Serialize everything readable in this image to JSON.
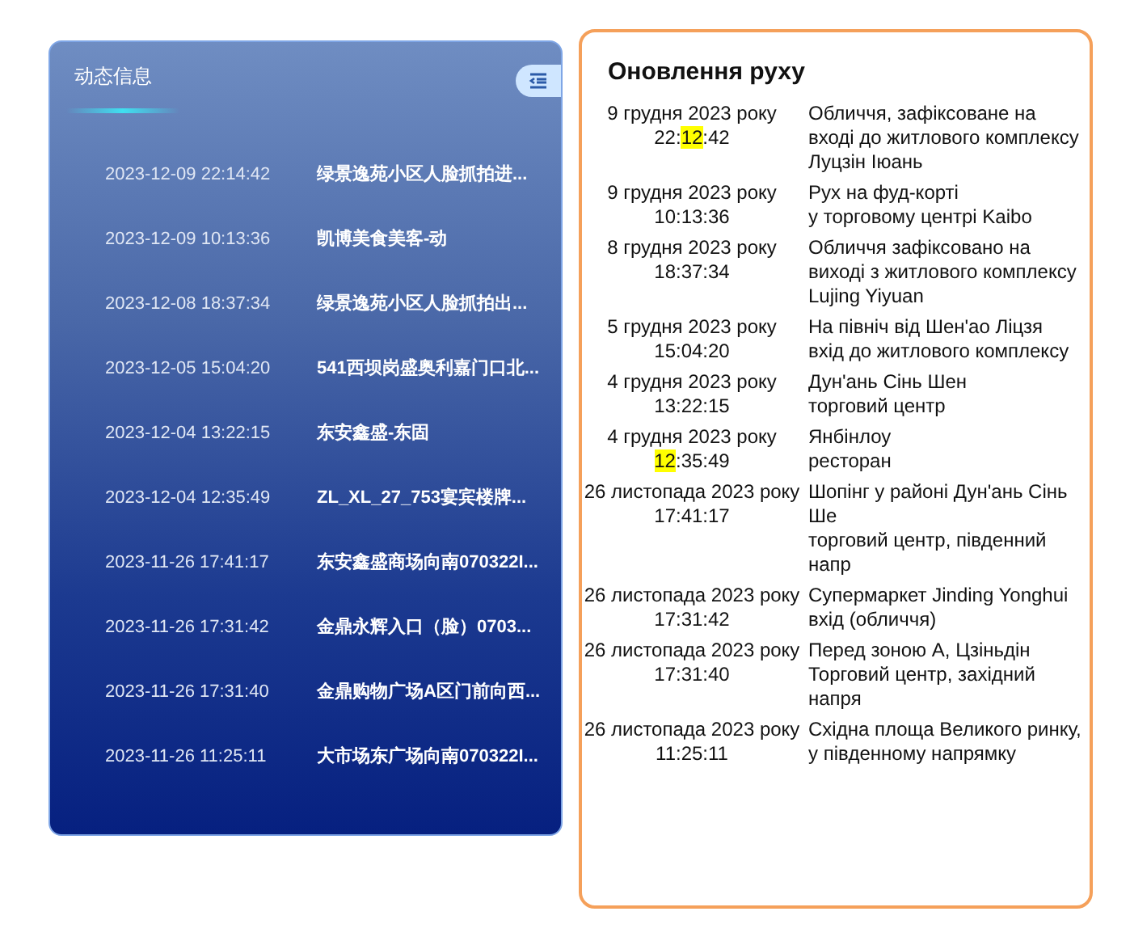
{
  "dynamic_panel": {
    "title": "动态信息",
    "items": [
      {
        "time": "2023-12-09 22:14:42",
        "text": "绿景逸苑小区人脸抓拍进..."
      },
      {
        "time": "2023-12-09 10:13:36",
        "text": "凯博美食美客-动"
      },
      {
        "time": "2023-12-08 18:37:34",
        "text": "绿景逸苑小区人脸抓拍出..."
      },
      {
        "time": "2023-12-05 15:04:20",
        "text": "541西坝岗盛奥利嘉门口北..."
      },
      {
        "time": "2023-12-04 13:22:15",
        "text": "东安鑫盛-东固"
      },
      {
        "time": "2023-12-04 12:35:49",
        "text": "ZL_XL_27_753宴宾楼牌..."
      },
      {
        "time": "2023-11-26 17:41:17",
        "text": "东安鑫盛商场向南070322I..."
      },
      {
        "time": "2023-11-26 17:31:42",
        "text": "金鼎永辉入口（脸）0703..."
      },
      {
        "time": "2023-11-26 17:31:40",
        "text": "金鼎购物广场A区门前向西..."
      },
      {
        "time": "2023-11-26 11:25:11",
        "text": "大市场东广场向南070322I..."
      }
    ]
  },
  "movement_panel": {
    "title": "Оновлення руху",
    "items": [
      {
        "date": "9 грудня 2023 року",
        "time_parts": [
          {
            "text": "22:",
            "highlighted": false
          },
          {
            "text": "12",
            "highlighted": true
          },
          {
            "text": ":42",
            "highlighted": false
          }
        ],
        "description": "Обличчя, зафіксоване на вході до житлового комплексу Луцзін Іюань"
      },
      {
        "date": "9 грудня 2023 року",
        "time_parts": [
          {
            "text": "10:13:36",
            "highlighted": false
          }
        ],
        "description": "Рух на фуд-корті\nу торговому центрі Kaibo"
      },
      {
        "date": "8 грудня 2023 року",
        "time_parts": [
          {
            "text": "18:37:34",
            "highlighted": false
          }
        ],
        "description": "Обличчя зафіксовано на виході з житлового комплексу Lujing Yiyuan"
      },
      {
        "date": "5 грудня 2023 року",
        "time_parts": [
          {
            "text": "15:04:20",
            "highlighted": false
          }
        ],
        "description": "На північ від Шен'ао Ліцзя\nвхід до житлового комплексу"
      },
      {
        "date": "4 грудня 2023 року",
        "time_parts": [
          {
            "text": "13:22:15",
            "highlighted": false
          }
        ],
        "description": "Дун'ань Сінь Шен\nторговий центр"
      },
      {
        "date": "4 грудня 2023 року",
        "time_parts": [
          {
            "text": "12",
            "highlighted": true
          },
          {
            "text": ":35:49",
            "highlighted": false
          }
        ],
        "description": "Янбінлоу\nресторан"
      },
      {
        "date": "26 листопада 2023 року",
        "time_parts": [
          {
            "text": "17:41:17",
            "highlighted": false
          }
        ],
        "description": "Шопінг у районі Дун'ань Сінь Ше\nторговий центр, південний напр"
      },
      {
        "date": "26 листопада 2023 року",
        "time_parts": [
          {
            "text": "17:31:42",
            "highlighted": false
          }
        ],
        "description": "Супермаркет Jinding Yonghui\nвхід (обличчя)"
      },
      {
        "date": "26 листопада 2023 року",
        "time_parts": [
          {
            "text": "17:31:40",
            "highlighted": false
          }
        ],
        "description": "Перед зоною А, Цзіньдін\nТорговий центр, західний напря"
      },
      {
        "date": "26 листопада 2023 року",
        "time_parts": [
          {
            "text": "11:25:11",
            "highlighted": false
          }
        ],
        "description": "Східна площа Великого ринку, у південному напрямку"
      }
    ]
  }
}
